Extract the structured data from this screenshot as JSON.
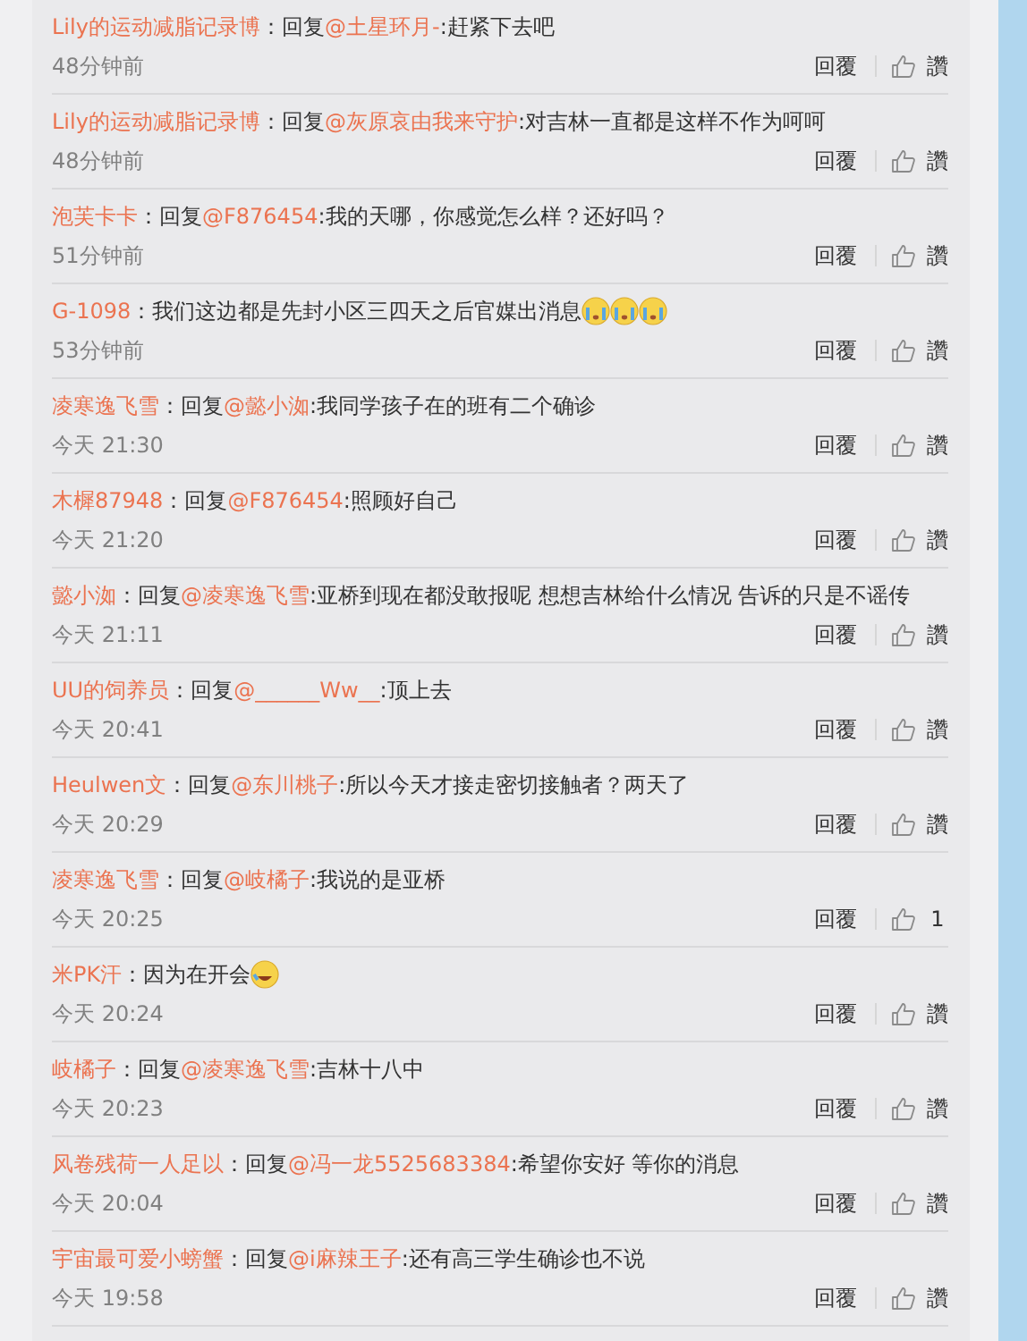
{
  "comments": [
    {
      "user": "Lily的运动减脂记录博",
      "prefix": "：回复",
      "reply_to": "@土星环月-",
      "text": ":赶紧下去吧",
      "time": "48分钟前",
      "reply_label": "回覆",
      "like_label": "讚"
    },
    {
      "user": "Lily的运动减脂记录博",
      "prefix": "：回复",
      "reply_to": "@灰原哀由我来守护",
      "text": ":对吉林一直都是这样不作为呵呵",
      "time": "48分钟前",
      "reply_label": "回覆",
      "like_label": "讚"
    },
    {
      "user": "泡芙卡卡",
      "prefix": "：回复",
      "reply_to": "@F876454",
      "text": ":我的天哪，你感觉怎么样？还好吗？",
      "time": "51分钟前",
      "reply_label": "回覆",
      "like_label": "讚"
    },
    {
      "user": "G-1098",
      "prefix": "：",
      "text": "我们这边都是先封小区三四天之后官媒出消息",
      "emojis": [
        {
          "kind": "crying"
        },
        {
          "kind": "crying"
        },
        {
          "kind": "crying"
        }
      ],
      "time": "53分钟前",
      "reply_label": "回覆",
      "like_label": "讚"
    },
    {
      "user": "凌寒逸飞雪",
      "prefix": "：回复",
      "reply_to": "@懿小洳",
      "text": ":我同学孩子在的班有二个确诊",
      "time": "今天 21:30",
      "reply_label": "回覆",
      "like_label": "讚"
    },
    {
      "user": "木樨87948",
      "prefix": "：回复",
      "reply_to": "@F876454",
      "text": ":照顾好自己",
      "time": "今天 21:20",
      "reply_label": "回覆",
      "like_label": "讚"
    },
    {
      "user": "懿小洳",
      "prefix": "：回复",
      "reply_to": "@凌寒逸飞雪",
      "text": ":亚桥到现在都没敢报呢 想想吉林给什么情况 告诉的只是不谣传",
      "time": "今天 21:11",
      "reply_label": "回覆",
      "like_label": "讚"
    },
    {
      "user": "UU的饲养员",
      "prefix": "：回复",
      "reply_to": "@______Ww__",
      "text": ":顶上去",
      "time": "今天 20:41",
      "reply_label": "回覆",
      "like_label": "讚"
    },
    {
      "user": "Heulwen文",
      "prefix": "：回复",
      "reply_to": "@东川桃子",
      "text": ":所以今天才接走密切接触者？两天了",
      "time": "今天 20:29",
      "reply_label": "回覆",
      "like_label": "讚"
    },
    {
      "user": "凌寒逸飞雪",
      "prefix": "：回复",
      "reply_to": "@岐橘子",
      "text": ":我说的是亚桥",
      "time": "今天 20:25",
      "reply_label": "回覆",
      "like_label": "1"
    },
    {
      "user": "米PK汗",
      "prefix": "：",
      "text": "因为在开会",
      "emojis": [
        {
          "kind": "laughing"
        }
      ],
      "time": "今天 20:24",
      "reply_label": "回覆",
      "like_label": "讚"
    },
    {
      "user": "岐橘子",
      "prefix": "：回复",
      "reply_to": "@凌寒逸飞雪",
      "text": ":吉林十八中",
      "time": "今天 20:23",
      "reply_label": "回覆",
      "like_label": "讚"
    },
    {
      "user": "风卷残荷一人足以",
      "prefix": "：回复",
      "reply_to": "@冯一龙5525683384",
      "text": ":希望你安好 等你的消息",
      "time": "今天 20:04",
      "reply_label": "回覆",
      "like_label": "讚"
    },
    {
      "user": "宇宙最可爱小螃蟹",
      "prefix": "：回复",
      "reply_to": "@i麻辣王子",
      "text": ":还有高三学生确诊也不说",
      "time": "今天 19:58",
      "reply_label": "回覆",
      "like_label": "讚"
    }
  ]
}
